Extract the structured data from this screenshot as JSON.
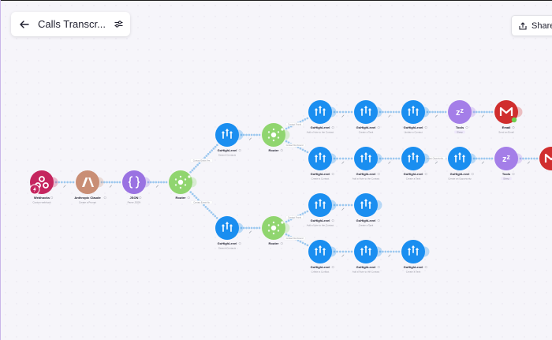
{
  "header": {
    "title": "Calls Transcr..."
  },
  "toolbar": {
    "share_label": "Share"
  },
  "colors": {
    "webhooks": "#c5255e",
    "anthropic": "#c98e75",
    "json": "#9a72e2",
    "router": "#90d56f",
    "gohighlevel": "#1a8ef0",
    "sleep": "#a47ee8",
    "email": "#d02e2e",
    "link_dot": "#9cc8ef"
  },
  "nodes": [
    {
      "id": "webhooks",
      "kind": "webhooks",
      "name": "Webhooks",
      "sub": "Custom webhook",
      "icon": "webhooks-icon"
    },
    {
      "id": "anthropic",
      "kind": "anthropic",
      "name": "Anthropic Claude",
      "sub": "Create a Prompt",
      "icon": "anthropic-icon"
    },
    {
      "id": "json",
      "kind": "json",
      "name": "JSON",
      "sub": "Parse JSON",
      "icon": "json-icon"
    },
    {
      "id": "router1",
      "kind": "router",
      "name": "Router",
      "sub": "",
      "icon": "router-icon"
    },
    {
      "id": "ghl_a",
      "kind": "gohighlevel",
      "name": "GoHighLevel",
      "sub": "Search Contacts",
      "icon": "gohighlevel-icon"
    },
    {
      "id": "ghl_b",
      "kind": "gohighlevel",
      "name": "GoHighLevel",
      "sub": "Search Contacts",
      "icon": "gohighlevel-icon"
    },
    {
      "id": "router2",
      "kind": "router",
      "name": "Router",
      "sub": "",
      "icon": "router-icon"
    },
    {
      "id": "router3",
      "kind": "router",
      "name": "Router",
      "sub": "",
      "icon": "router-icon"
    },
    {
      "id": "r1n1",
      "kind": "gohighlevel",
      "name": "GoHighLevel",
      "sub": "Add a Note to the Contact",
      "icon": "gohighlevel-icon"
    },
    {
      "id": "r1n2",
      "kind": "gohighlevel",
      "name": "GoHighLevel",
      "sub": "Create a Task",
      "icon": "gohighlevel-icon"
    },
    {
      "id": "r1n3",
      "kind": "gohighlevel",
      "name": "GoHighLevel",
      "sub": "Update a Contact",
      "icon": "gohighlevel-icon"
    },
    {
      "id": "r1n4",
      "kind": "sleep",
      "name": "Tools",
      "sub": "Sleep",
      "icon": "sleep-icon"
    },
    {
      "id": "r1n5",
      "kind": "email",
      "name": "Email",
      "sub": "Send an Email",
      "icon": "gmail-icon"
    },
    {
      "id": "r2n1",
      "kind": "gohighlevel",
      "name": "GoHighLevel",
      "sub": "Create a Contact",
      "icon": "gohighlevel-icon"
    },
    {
      "id": "r2n2",
      "kind": "gohighlevel",
      "name": "GoHighLevel",
      "sub": "Add a Note to the Contact",
      "icon": "gohighlevel-icon"
    },
    {
      "id": "r2n3",
      "kind": "gohighlevel",
      "name": "GoHighLevel",
      "sub": "Create a Task",
      "icon": "gohighlevel-icon"
    },
    {
      "id": "r2n4",
      "kind": "gohighlevel",
      "name": "GoHighLevel",
      "sub": "Create an Opportunity",
      "icon": "gohighlevel-icon"
    },
    {
      "id": "r2n5",
      "kind": "sleep",
      "name": "Tools",
      "sub": "Sleep",
      "icon": "sleep-icon"
    },
    {
      "id": "r2n6",
      "kind": "email",
      "name": "",
      "sub": "",
      "icon": "gmail-icon"
    },
    {
      "id": "r3n1",
      "kind": "gohighlevel",
      "name": "GoHighLevel",
      "sub": "Add a Note to the Contact",
      "icon": "gohighlevel-icon"
    },
    {
      "id": "r3n2",
      "kind": "gohighlevel",
      "name": "GoHighLevel",
      "sub": "Create a Task",
      "icon": "gohighlevel-icon"
    },
    {
      "id": "r4n1",
      "kind": "gohighlevel",
      "name": "GoHighLevel",
      "sub": "Create a Contact",
      "icon": "gohighlevel-icon"
    },
    {
      "id": "r4n2",
      "kind": "gohighlevel",
      "name": "GoHighLevel",
      "sub": "Add a Note to the Contact",
      "icon": "gohighlevel-icon"
    },
    {
      "id": "r4n3",
      "kind": "gohighlevel",
      "name": "GoHighLevel",
      "sub": "Create a Task",
      "icon": "gohighlevel-icon"
    }
  ],
  "links": [
    [
      "webhooks",
      "anthropic"
    ],
    [
      "anthropic",
      "json"
    ],
    [
      "json",
      "router1"
    ],
    [
      "router1",
      "ghl_a"
    ],
    [
      "router1",
      "ghl_b"
    ],
    [
      "ghl_a",
      "router2"
    ],
    [
      "ghl_b",
      "router3"
    ],
    [
      "router2",
      "r1n1"
    ],
    [
      "r1n1",
      "r1n2"
    ],
    [
      "r1n2",
      "r1n3"
    ],
    [
      "r1n3",
      "r1n4"
    ],
    [
      "r1n4",
      "r1n5"
    ],
    [
      "router2",
      "r2n1"
    ],
    [
      "r2n1",
      "r2n2"
    ],
    [
      "r2n2",
      "r2n3"
    ],
    [
      "r2n3",
      "r2n4"
    ],
    [
      "r2n4",
      "r2n5"
    ],
    [
      "r2n5",
      "r2n6"
    ],
    [
      "router3",
      "r3n1"
    ],
    [
      "r3n1",
      "r3n2"
    ],
    [
      "router3",
      "r4n1"
    ],
    [
      "r4n1",
      "r4n2"
    ],
    [
      "r4n2",
      "r4n3"
    ]
  ],
  "route_labels": [
    {
      "from": "router1",
      "to": "ghl_a",
      "text": "Contact Exists Yes"
    },
    {
      "from": "router1",
      "to": "ghl_b",
      "text": "Contact Exists No"
    },
    {
      "from": "router2",
      "to": "r1n1",
      "text": "Contact Found"
    },
    {
      "from": "router2",
      "to": "r2n1",
      "text": "Contact Not Found"
    },
    {
      "from": "r2n3",
      "to": "r2n4",
      "text": "Contact Opportunity"
    },
    {
      "from": "router3",
      "to": "r3n1",
      "text": "Contact Found"
    },
    {
      "from": "router3",
      "to": "r4n1",
      "text": "Contact Not Found"
    }
  ]
}
